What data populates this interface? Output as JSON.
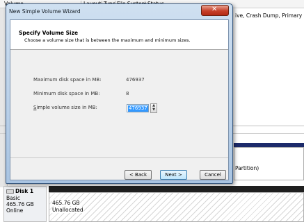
{
  "background": {
    "columns": [
      "Volume",
      "Layout",
      "Type",
      "File System",
      "Status"
    ],
    "status_overflow": "ive, Crash Dump, Primary Part",
    "partition_overflow": "Partition)",
    "disk": {
      "name": "Disk 1",
      "type": "Basic",
      "size": "465.76 GB",
      "state": "Online",
      "region_size": "465.76 GB",
      "region_label": "Unallocated"
    }
  },
  "dialog": {
    "title": "New Simple Volume Wizard",
    "close_glyph": "✕",
    "header_title": "Specify Volume Size",
    "header_subtitle": "Choose a volume size that is between the maximum and minimum sizes.",
    "fields": [
      {
        "label": "Maximum disk space in MB:",
        "value": "476937"
      },
      {
        "label": "Minimum disk space in MB:",
        "value": "8"
      }
    ],
    "size_label_mnemonic": "S",
    "size_label_rest": "imple volume size in MB:",
    "size_value": "476937",
    "buttons": {
      "back": "< Back",
      "next": "Next >",
      "cancel": "Cancel"
    }
  }
}
